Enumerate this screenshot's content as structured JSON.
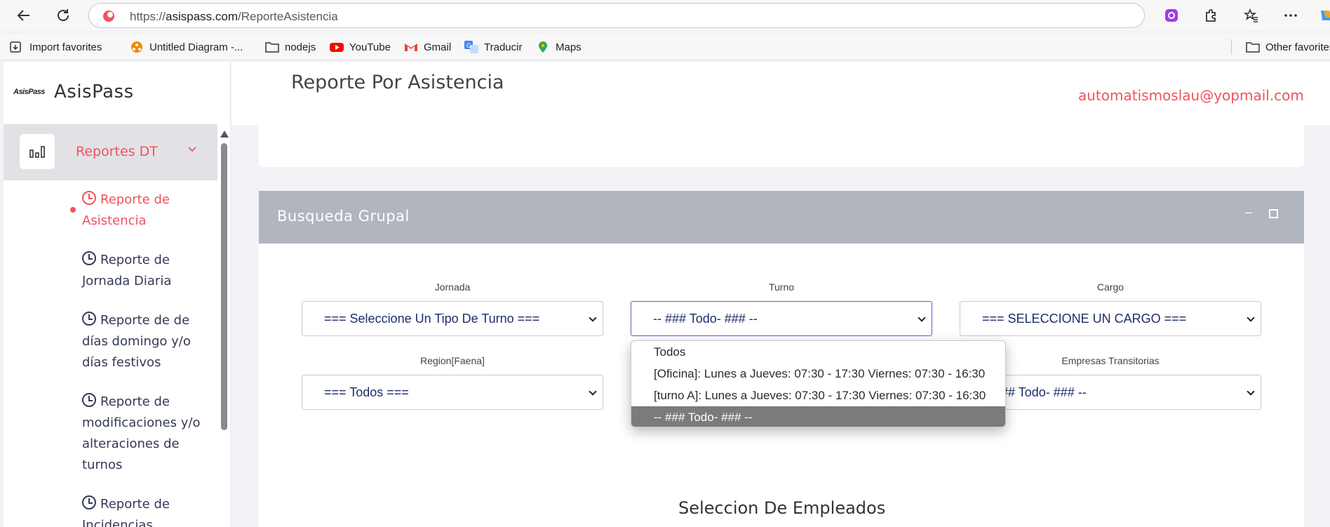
{
  "browser": {
    "url_prefix": "https://",
    "url_host": "asispass.com",
    "url_path": "/ReporteAsistencia"
  },
  "bookmarks": [
    {
      "label": "Import favorites",
      "icon": "import-icon"
    },
    {
      "label": "Untitled Diagram -...",
      "icon": "drawio-icon"
    },
    {
      "label": "nodejs",
      "icon": "folder-icon"
    },
    {
      "label": "YouTube",
      "icon": "youtube-icon"
    },
    {
      "label": "Gmail",
      "icon": "gmail-icon"
    },
    {
      "label": "Traducir",
      "icon": "translate-icon"
    },
    {
      "label": "Maps",
      "icon": "maps-icon"
    },
    {
      "label": "Other favorites",
      "icon": "folder-icon"
    }
  ],
  "app": {
    "logo_text": "AsisPass",
    "brand": "AsisPass",
    "page_title": "Reporte Por Asistencia",
    "user_email": "automatismoslau@yopmail.com"
  },
  "sidebar": {
    "active_section": "Reportes DT",
    "items": [
      {
        "label": "Reporte de Asistencia",
        "active": true
      },
      {
        "label": "Reporte de Jornada Diaria",
        "active": false
      },
      {
        "label": "Reporte de de días domingo y/o días festivos",
        "active": false
      },
      {
        "label": "Reporte de modificaciones y/o alteraciones de turnos",
        "active": false
      },
      {
        "label": "Reporte de Incidencias",
        "active": false
      }
    ]
  },
  "card": {
    "title": "Busqueda Grupal"
  },
  "filters": {
    "jornada_label": "Jornada",
    "jornada_value": "=== Seleccione Un Tipo De Turno ===",
    "turno_label": "Turno",
    "turno_value": "-- ### Todo- ### --",
    "cargo_label": "Cargo",
    "cargo_value": "=== SELECCIONE UN CARGO ===",
    "region_label": "Region[Faena]",
    "region_value": "=== Todos ===",
    "empresas_label": "Empresas Transitorias",
    "empresas_value": "-- ### Todo- ### --"
  },
  "turno_dropdown": {
    "options": [
      "Todos",
      "[Oficina]: Lunes a Jueves: 07:30 - 17:30 Viernes: 07:30 - 16:30",
      "[turno A]: Lunes a Jueves: 07:30 - 17:30 Viernes: 07:30 - 16:30",
      "-- ### Todo- ### --"
    ],
    "selected": "-- ### Todo- ### --"
  },
  "section": {
    "empleados_title": "Seleccion De Empleados"
  },
  "colors": {
    "accent": "#f0535c",
    "card_header": "#b1b5be",
    "select_text": "#1e2d6b"
  }
}
